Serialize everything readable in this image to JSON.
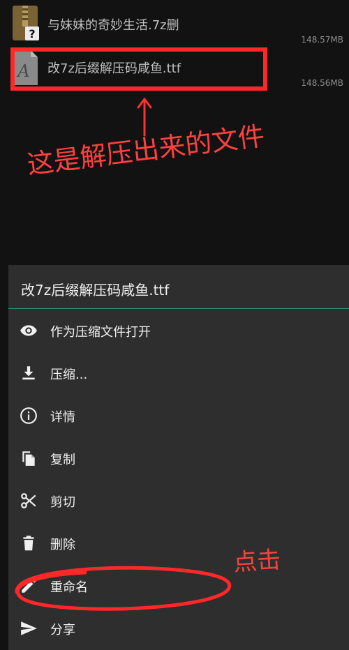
{
  "files": [
    {
      "name": "与妹妹的奇妙生活.7z删",
      "size": "148.57MB",
      "icon": "archive-unknown-icon"
    },
    {
      "name": "改7z后缀解压码咸鱼.ttf",
      "size": "148.56MB",
      "icon": "font-file-icon"
    }
  ],
  "annotations": {
    "extracted_note": "这是解压出来的文件",
    "arrow_glyph": "↑",
    "click_note": "点击",
    "color": "#ff2828"
  },
  "dialog": {
    "title": "改7z后缀解压码咸鱼.ttf",
    "divider_color": "#3a8d86",
    "items": [
      {
        "label": "作为压缩文件打开",
        "icon": "eye-icon"
      },
      {
        "label": "压缩...",
        "icon": "download-icon"
      },
      {
        "label": "详情",
        "icon": "info-icon"
      },
      {
        "label": "复制",
        "icon": "copy-icon"
      },
      {
        "label": "剪切",
        "icon": "scissors-icon"
      },
      {
        "label": "删除",
        "icon": "trash-icon"
      },
      {
        "label": "重命名",
        "icon": "pencil-icon"
      },
      {
        "label": "分享",
        "icon": "send-icon"
      }
    ]
  }
}
